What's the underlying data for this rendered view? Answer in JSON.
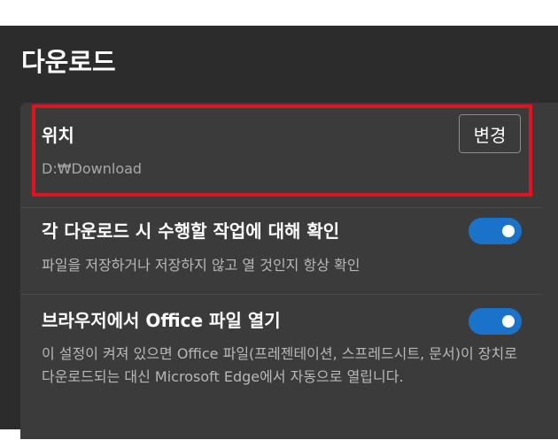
{
  "page": {
    "title": "다운로드"
  },
  "location": {
    "label": "위치",
    "path": "D:\\Download",
    "path_display": "D:₩Download",
    "change_button": "변경"
  },
  "ask_each_download": {
    "label": "각 다운로드 시 수행할 작업에 대해 확인",
    "description": "파일을 저장하거나 저장하지 않고 열 것인지 항상 확인",
    "enabled": true
  },
  "open_office_in_browser": {
    "label": "브라우저에서 Office 파일 열기",
    "description": "이 설정이 켜져 있으면 Office 파일(프레젠테이션, 스프레드시트, 문서)이 장치로 다운로드되는 대신 Microsoft Edge에서 자동으로 열립니다.",
    "enabled": true
  },
  "colors": {
    "panel_background": "#2c2c2c",
    "card_background": "#3b3b3b",
    "toggle_on": "#1a73c8",
    "highlight_border": "#e0141e"
  }
}
